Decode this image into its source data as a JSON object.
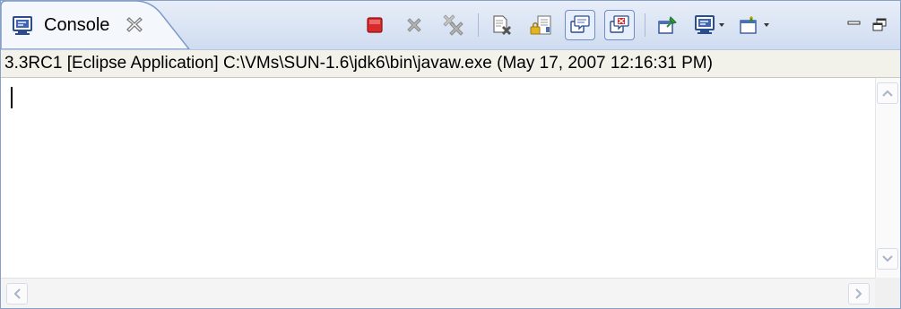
{
  "tab": {
    "label": "Console",
    "icon": "console-icon",
    "close_icon": "close-icon"
  },
  "toolbar": {
    "buttons": [
      {
        "name": "terminate-button",
        "icon": "red-square-icon"
      },
      {
        "name": "remove-launch-button",
        "icon": "gray-x-icon"
      },
      {
        "name": "remove-all-terminated-button",
        "icon": "double-gray-x-icon"
      },
      {
        "name": "clear-console-button",
        "icon": "clear-page-icon"
      },
      {
        "name": "scroll-lock-button",
        "icon": "scroll-lock-icon"
      },
      {
        "name": "show-on-stdout-button",
        "icon": "console-bubble-icon",
        "pressed": true
      },
      {
        "name": "show-on-stderr-button",
        "icon": "console-bubble-error-icon",
        "pressed": true
      },
      {
        "name": "pin-console-button",
        "icon": "pin-icon"
      },
      {
        "name": "display-console-button",
        "icon": "monitor-icon"
      },
      {
        "name": "open-console-button",
        "icon": "new-console-icon"
      },
      {
        "name": "minimize-button",
        "icon": "minimize-icon"
      },
      {
        "name": "maximize-button",
        "icon": "maximize-icon"
      }
    ]
  },
  "process": {
    "label": "3.3RC1 [Eclipse Application] C:\\VMs\\SUN-1.6\\jdk6\\bin\\javaw.exe (May 17, 2007 12:16:31 PM)"
  },
  "colors": {
    "terminate": "#d82a2a",
    "tab_border": "#7f9ac9",
    "toolbar_pressed": "#6f8dc4"
  }
}
